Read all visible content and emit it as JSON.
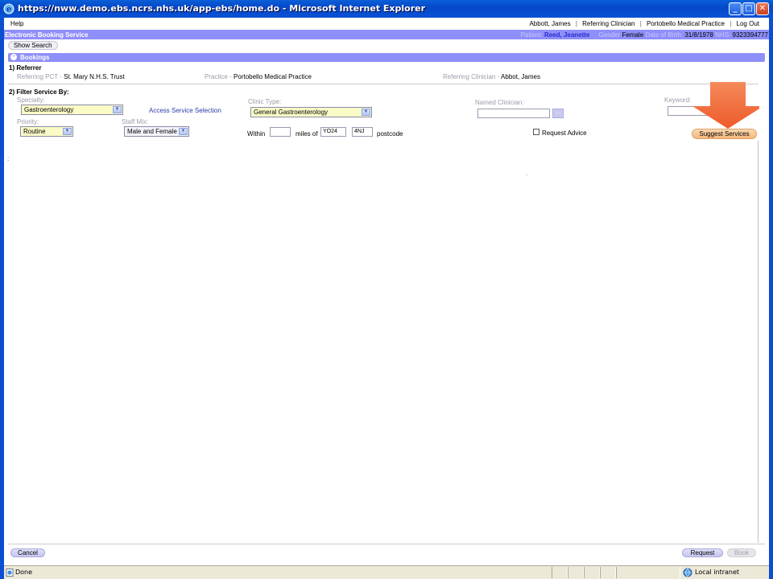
{
  "window": {
    "title": "https://nww.demo.ebs.ncrs.nhs.uk/app-ebs/home.do - Microsoft Internet Explorer",
    "minimize": "_",
    "maximize": "□",
    "close": "✕"
  },
  "menu": {
    "help": "Help"
  },
  "user": {
    "name": "Abbott, James",
    "role": "Referring Clinician",
    "practice": "Portobello Medical Practice",
    "logout": "Log Out",
    "sep": "|"
  },
  "header": {
    "app_title": "Electronic Booking Service",
    "patient_label": "Patient:",
    "patient_name": "Reed, Jeanette",
    "gender_label": "Gender",
    "gender": "Female",
    "dob_label": "Date of Birth:",
    "dob": "31/8/1978",
    "nhs_label": "NHS:",
    "nhs": "9323394777"
  },
  "show_search": "Show Search",
  "bookings": {
    "label": "Bookings",
    "toggle": "−"
  },
  "referrer": {
    "title": "1) Referrer",
    "pct_label": "Referring PCT -",
    "pct": "St. Mary N.H.S. Trust",
    "practice_label": "Practice -",
    "practice": "Portobello Medical Practice",
    "clinician_label": "Referring Clinician -",
    "clinician": "Abbot, James"
  },
  "filter": {
    "title": "2) Filter Service By:",
    "specialty_label": "Specialty:",
    "specialty": "Gastroenterology",
    "access_link": "Access Service Selection",
    "clinic_type_label": "Clinic Type:",
    "clinic_type": "General Gastroenterology",
    "named_clinician_label": "Named Clinician:",
    "named_clinician_value": "",
    "named_clinician_btn": "...",
    "keyword_label": "Keyword:",
    "keyword_value": "",
    "priority_label": "Priority:",
    "priority": "Routine",
    "staff_mix_label": "Staff Mix:",
    "staff_mix": "Male and Female",
    "within_label": "Within",
    "miles_value": "",
    "miles_of_label": "miles of",
    "postcode_part1": "YO24",
    "postcode_part2": "4NJ",
    "postcode_label": "postcode",
    "request_advice_label": "Request Advice",
    "request_advice_checked": false,
    "suggest_btn": "Suggest Services"
  },
  "stray_marks": {
    "left_colon": ":",
    "dot": "."
  },
  "footer": {
    "cancel": "Cancel",
    "request": "Request",
    "book": "Book"
  },
  "status": {
    "done": "Done",
    "zone": "Local intranet"
  },
  "colors": {
    "header_bar": "#8f8ffa",
    "select_bg": "#fbfbc8",
    "suggest_btn": "#f6b77d",
    "pointer_arrow": "#f06a3a"
  }
}
